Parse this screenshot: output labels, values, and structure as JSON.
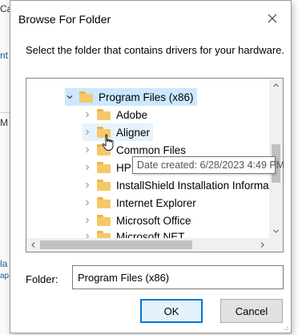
{
  "background_window": {
    "fragments": [
      "Ca",
      "nt",
      "M",
      "la",
      "ap"
    ]
  },
  "dialog": {
    "title": "Browse For Folder",
    "instruction": "Select the folder that contains drivers for your hardware.",
    "tree": {
      "items": [
        {
          "label": "Program Files (x86)",
          "expanded": true,
          "level": 0,
          "state": "selected"
        },
        {
          "label": "Adobe",
          "expanded": false,
          "level": 1,
          "state": ""
        },
        {
          "label": "Aligner",
          "expanded": false,
          "level": 1,
          "state": "hovered"
        },
        {
          "label": "Common Files",
          "expanded": false,
          "level": 1,
          "state": ""
        },
        {
          "label": "HP",
          "expanded": false,
          "level": 1,
          "state": ""
        },
        {
          "label": "InstallShield Installation Informat",
          "expanded": false,
          "level": 1,
          "state": ""
        },
        {
          "label": "Internet Explorer",
          "expanded": false,
          "level": 1,
          "state": ""
        },
        {
          "label": "Microsoft Office",
          "expanded": false,
          "level": 1,
          "state": ""
        },
        {
          "label": "Microsoft.NET",
          "expanded": false,
          "level": 1,
          "state": ""
        }
      ]
    },
    "tooltip": "Date created: 6/28/2023 4:49 PM",
    "folder_label": "Folder:",
    "folder_value": "Program Files (x86)",
    "ok_label": "OK",
    "cancel_label": "Cancel"
  },
  "icons": {
    "close": "close-icon",
    "expand": "chevron-down-icon",
    "collapse": "chevron-right-icon",
    "folder": "folder-icon",
    "cursor": "hand-pointer-icon"
  },
  "colors": {
    "folder": "#f4c969",
    "selection": "#cce8ff",
    "hover": "#e5f3ff",
    "accent": "#0078d7"
  }
}
